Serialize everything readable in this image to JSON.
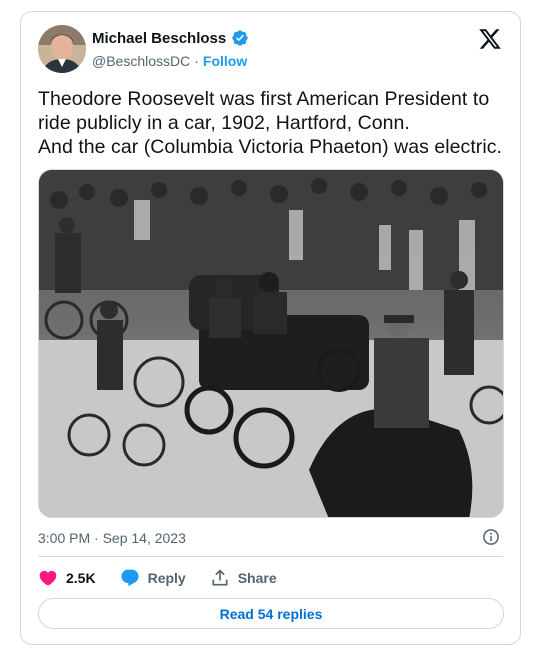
{
  "author": {
    "name": "Michael Beschloss",
    "handle": "@BeschlossDC",
    "separator": "·",
    "follow_label": "Follow"
  },
  "tweet": {
    "lines": [
      "Theodore Roosevelt was first American President to",
      "ride publicly in a car, 1902, Hartford, Conn.",
      "And the car (Columbia Victoria Phaeton) was electric."
    ],
    "timestamp": "3:00 PM · Sep 14, 2023"
  },
  "actions": {
    "likes": "2.5K",
    "reply_label": "Reply",
    "share_label": "Share"
  },
  "read_replies_label": "Read 54 replies",
  "icons": {
    "brand": "x-logo-icon",
    "verified": "verified-badge-icon",
    "info": "info-icon",
    "like": "heart-icon",
    "reply": "speech-bubble-icon",
    "share": "share-icon"
  },
  "colors": {
    "accent": "#1d9bf0",
    "link": "#006fd6",
    "like": "#f91880",
    "muted": "#536471",
    "border": "#cfd9de"
  }
}
